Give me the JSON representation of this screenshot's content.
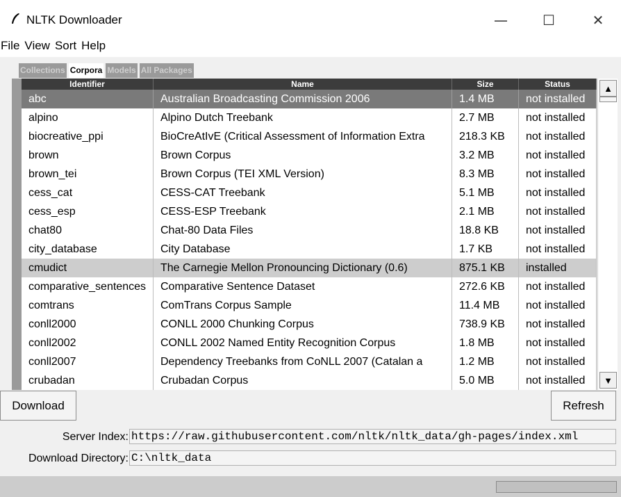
{
  "window": {
    "title": "NLTK Downloader",
    "controls": {
      "minimize": "—",
      "maximize": "☐",
      "close": "✕"
    }
  },
  "menu": [
    "File",
    "View",
    "Sort",
    "Help"
  ],
  "tabs": [
    {
      "label": "Collections",
      "active": false
    },
    {
      "label": "Corpora",
      "active": true
    },
    {
      "label": "Models",
      "active": false
    },
    {
      "label": "All Packages",
      "active": false
    }
  ],
  "table": {
    "columns": [
      "Identifier",
      "Name",
      "Size",
      "Status"
    ],
    "rows": [
      {
        "id": "abc",
        "name": "Australian Broadcasting Commission 2006",
        "size": "1.4 MB",
        "status": "not installed",
        "state": "selected"
      },
      {
        "id": "alpino",
        "name": "Alpino Dutch Treebank",
        "size": "2.7 MB",
        "status": "not installed"
      },
      {
        "id": "biocreative_ppi",
        "name": "BioCreAtIvE (Critical Assessment of Information Extra",
        "size": "218.3 KB",
        "status": "not installed"
      },
      {
        "id": "brown",
        "name": "Brown Corpus",
        "size": "3.2 MB",
        "status": "not installed"
      },
      {
        "id": "brown_tei",
        "name": "Brown Corpus (TEI XML Version)",
        "size": "8.3 MB",
        "status": "not installed"
      },
      {
        "id": "cess_cat",
        "name": "CESS-CAT Treebank",
        "size": "5.1 MB",
        "status": "not installed"
      },
      {
        "id": "cess_esp",
        "name": "CESS-ESP Treebank",
        "size": "2.1 MB",
        "status": "not installed"
      },
      {
        "id": "chat80",
        "name": "Chat-80 Data Files",
        "size": "18.8 KB",
        "status": "not installed"
      },
      {
        "id": "city_database",
        "name": "City Database",
        "size": "1.7 KB",
        "status": "not installed"
      },
      {
        "id": "cmudict",
        "name": "The Carnegie Mellon Pronouncing Dictionary (0.6)",
        "size": "875.1 KB",
        "status": "installed",
        "state": "installed"
      },
      {
        "id": "comparative_sentences",
        "name": "Comparative Sentence Dataset",
        "size": "272.6 KB",
        "status": "not installed"
      },
      {
        "id": "comtrans",
        "name": "ComTrans Corpus Sample",
        "size": "11.4 MB",
        "status": "not installed"
      },
      {
        "id": "conll2000",
        "name": "CONLL 2000 Chunking Corpus",
        "size": "738.9 KB",
        "status": "not installed"
      },
      {
        "id": "conll2002",
        "name": "CONLL 2002 Named Entity Recognition Corpus",
        "size": "1.8 MB",
        "status": "not installed"
      },
      {
        "id": "conll2007",
        "name": "Dependency Treebanks from CoNLL 2007 (Catalan a",
        "size": "1.2 MB",
        "status": "not installed"
      },
      {
        "id": "crubadan",
        "name": "Crubadan Corpus",
        "size": "5.0 MB",
        "status": "not installed"
      }
    ]
  },
  "scrollbar": {
    "up": "▲",
    "down": "▼"
  },
  "buttons": {
    "download": "Download",
    "refresh": "Refresh"
  },
  "server_index": {
    "label": "Server Index:",
    "value": "https://raw.githubusercontent.com/nltk/nltk_data/gh-pages/index.xml"
  },
  "download_directory": {
    "label": "Download Directory:",
    "value": "C:\\nltk_data"
  }
}
